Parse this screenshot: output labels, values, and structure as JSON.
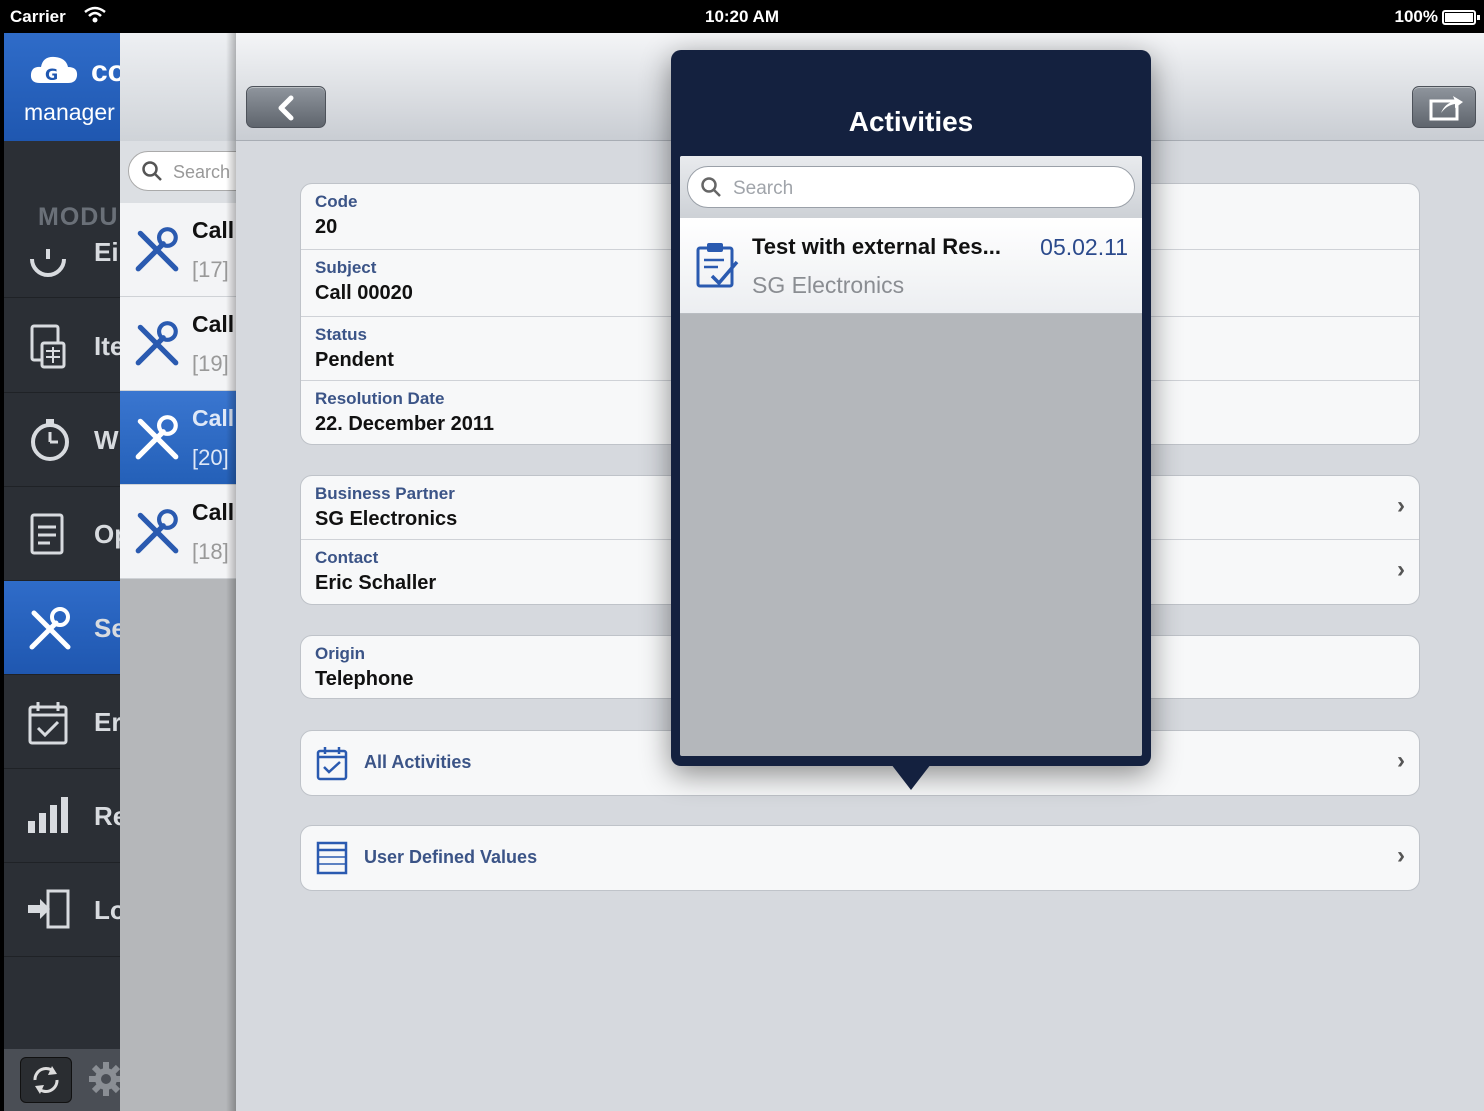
{
  "status_bar": {
    "carrier": "Carrier",
    "time": "10:20 AM",
    "battery": "100%"
  },
  "brand": {
    "line1": "co",
    "line2": "manager"
  },
  "modules": {
    "label": "MODU",
    "items": [
      {
        "label": "Ei",
        "icon": "dashboard-icon"
      },
      {
        "label": "Ite",
        "icon": "items-icon"
      },
      {
        "label": "W",
        "icon": "clock-icon"
      },
      {
        "label": "Op",
        "icon": "opportunities-icon"
      },
      {
        "label": "Se",
        "icon": "service-icon",
        "active": true
      },
      {
        "label": "Er",
        "icon": "calendar-icon"
      },
      {
        "label": "Re",
        "icon": "reports-icon"
      },
      {
        "label": "Lo",
        "icon": "logout-icon"
      }
    ]
  },
  "calls_list": {
    "search_placeholder": "Search",
    "rows": [
      {
        "title": "Call",
        "number": "[17]"
      },
      {
        "title": "Call",
        "number": "[19]"
      },
      {
        "title": "Call",
        "number": "[20]",
        "active": true
      },
      {
        "title": "Call",
        "number": "[18]"
      }
    ]
  },
  "detail": {
    "code_label": "Code",
    "code": "20",
    "subject_label": "Subject",
    "subject": "Call 00020",
    "status_label": "Status",
    "status": "Pendent",
    "resolution_label": "Resolution Date",
    "resolution": "22. December 2011",
    "partner_label": "Business Partner",
    "partner": "SG Electronics",
    "contact_label": "Contact",
    "contact": "Eric Schaller",
    "origin_label": "Origin",
    "origin": "Telephone",
    "all_activities": "All Activities",
    "udv": "User Defined Values"
  },
  "popover": {
    "title": "Activities",
    "search_placeholder": "Search",
    "items": [
      {
        "title": "Test with external Res...",
        "date": "05.02.11",
        "subtitle": "SG Electronics"
      }
    ]
  },
  "colors": {
    "accent": "#2460b8",
    "popover_bg": "#14213f",
    "label_blue": "#3b5487"
  }
}
